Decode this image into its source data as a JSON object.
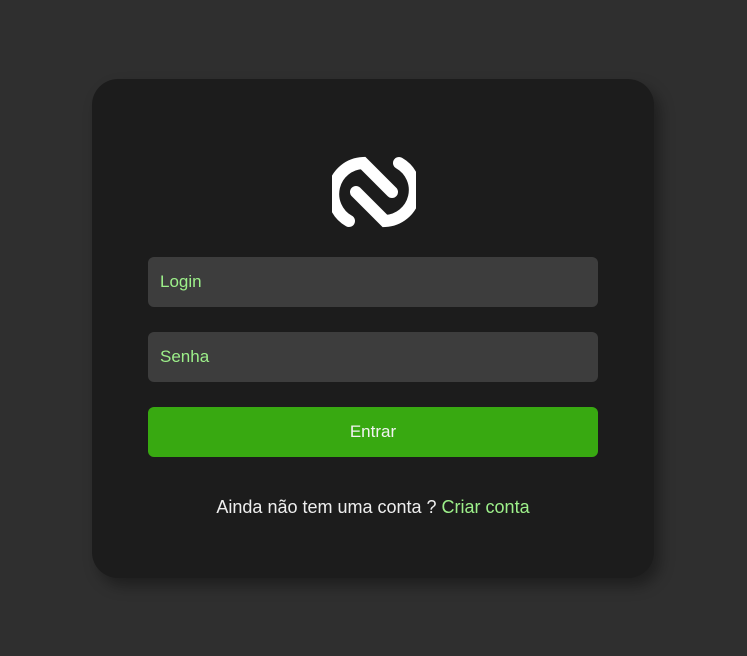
{
  "login_form": {
    "logo_icon": "n-swirl-logo-icon",
    "login": {
      "value": "",
      "placeholder": "Login"
    },
    "password": {
      "value": "",
      "placeholder": "Senha"
    },
    "submit_label": "Entrar",
    "signup_prompt": "Ainda não tem uma conta ?",
    "signup_link": "Criar conta"
  },
  "colors": {
    "background": "#2f2f2f",
    "card": "#1c1c1c",
    "input_background": "#3d3d3d",
    "accent_text": "#9df08a",
    "button": "#38a911",
    "text": "#eeeeee"
  }
}
